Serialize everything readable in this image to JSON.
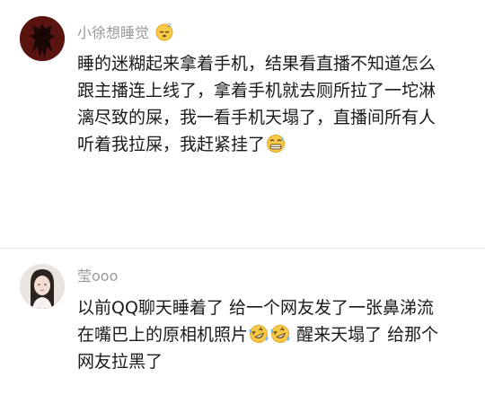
{
  "comments": [
    {
      "username": "小徐想睡觉",
      "username_emoji": "sleeping-face-icon",
      "lines": [
        "睡的迷糊起来拿着手机，结果看直播不知道怎么",
        "跟主播连上线了，拿着手机就去厕所拉了一坨淋",
        "漓尽致的屎，我一看手机天塌了，直播间所有人",
        "听着我拉屎，我赶紧挂了"
      ],
      "trailing_emoji": "grimacing-sweat-face-icon"
    },
    {
      "username": "莹ooo",
      "lines": [
        "以前QQ聊天睡着了 给一个网友发了一张鼻涕流",
        "在嘴巴上的原相机照片",
        "醒来天塌了 给那个",
        "网友拉黑了"
      ],
      "inline_emojis": [
        "rolling-laughing-face-icon",
        "rolling-laughing-face-icon"
      ]
    }
  ],
  "colors": {
    "username": "#9a9a9a",
    "text": "#1a1a1a",
    "background": "#ffffff"
  }
}
